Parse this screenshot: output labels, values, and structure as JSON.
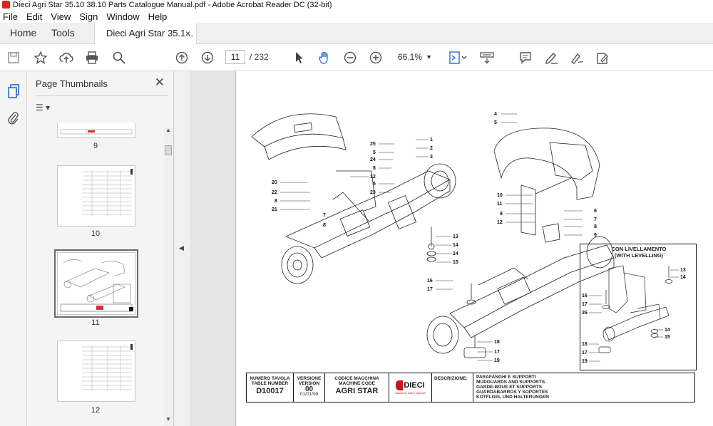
{
  "window": {
    "title": "Dieci Agri Star 35.10 38.10 Parts Catalogue Manual.pdf - Adobe Acrobat Reader DC (32-bit)"
  },
  "menu": [
    "File",
    "Edit",
    "View",
    "Sign",
    "Window",
    "Help"
  ],
  "tabs": {
    "home": "Home",
    "tools": "Tools",
    "document": "Dieci Agri Star 35.1...",
    "close": "×"
  },
  "toolbar": {
    "page_current": "11",
    "page_total": "/ 232",
    "zoom": "66.1%"
  },
  "thumbnails_panel": {
    "title": "Page Thumbnails",
    "close": "✕",
    "options": "☰ ▾",
    "pages": [
      "9",
      "10",
      "11",
      "12"
    ],
    "selected_page": "11"
  },
  "drawing": {
    "callouts_left": [
      "25",
      "5",
      "24",
      "8",
      "5",
      "23",
      "20",
      "22",
      "8",
      "21",
      "7",
      "8",
      "1",
      "2",
      "3",
      "12"
    ],
    "callouts_mid": [
      "13",
      "14",
      "14",
      "15",
      "16",
      "17",
      "18",
      "17",
      "19"
    ],
    "callouts_right": [
      "4",
      "5",
      "10",
      "11",
      "8",
      "12",
      "6",
      "7",
      "8",
      "9"
    ],
    "levelling_title_1": "CON LIVELLAMENTO",
    "levelling_title_2": "(WITH LEVELLING)",
    "levelling_callouts": [
      "13",
      "14",
      "16",
      "17",
      "26",
      "14",
      "15",
      "18",
      "17",
      "19"
    ]
  },
  "title_block": {
    "table_number_label": "NUMERO TAVOLA\nTABLE NUMBER",
    "table_number": "D10017",
    "version_label": "VERSIONE\nVERSION",
    "version": "00",
    "version_date": "01/01/09",
    "machine_code_label": "CODICE MACCHINA\nMACHINE CODE",
    "machine_code": "AGRI STAR",
    "brand": "DIECI",
    "brand_sub": "macchine edili e agricole",
    "description_label": "DESCRIZIONE:",
    "description_lines": [
      "PARAFANGHI E SUPPORTI",
      "MUDGUARDS AND SUPPORTS",
      "GARDE-BOUE ET SUPPORTS",
      "GUARDABARROS Y SOPORTES",
      "KOTFLGEL UND HALTERUNGEN"
    ]
  }
}
